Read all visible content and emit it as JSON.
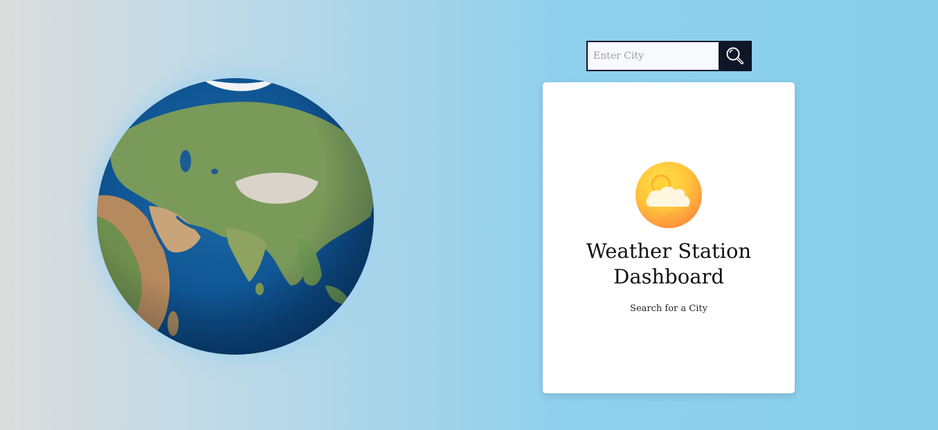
{
  "search": {
    "placeholder": "Enter City",
    "value": "",
    "button_icon": "search-icon"
  },
  "card": {
    "icon": "partly-cloudy-rain-icon",
    "title": "Weather Station Dashboard",
    "subtitle": "Search for a City"
  },
  "globe": {
    "icon": "earth-globe-image"
  },
  "colors": {
    "search_button_bg": "#0e1628",
    "card_bg": "#ffffff",
    "background_left": "#dcdcdc",
    "background_right": "#87ceeb",
    "icon_sun": "#ffcc33",
    "icon_orange": "#ff9a3c"
  }
}
